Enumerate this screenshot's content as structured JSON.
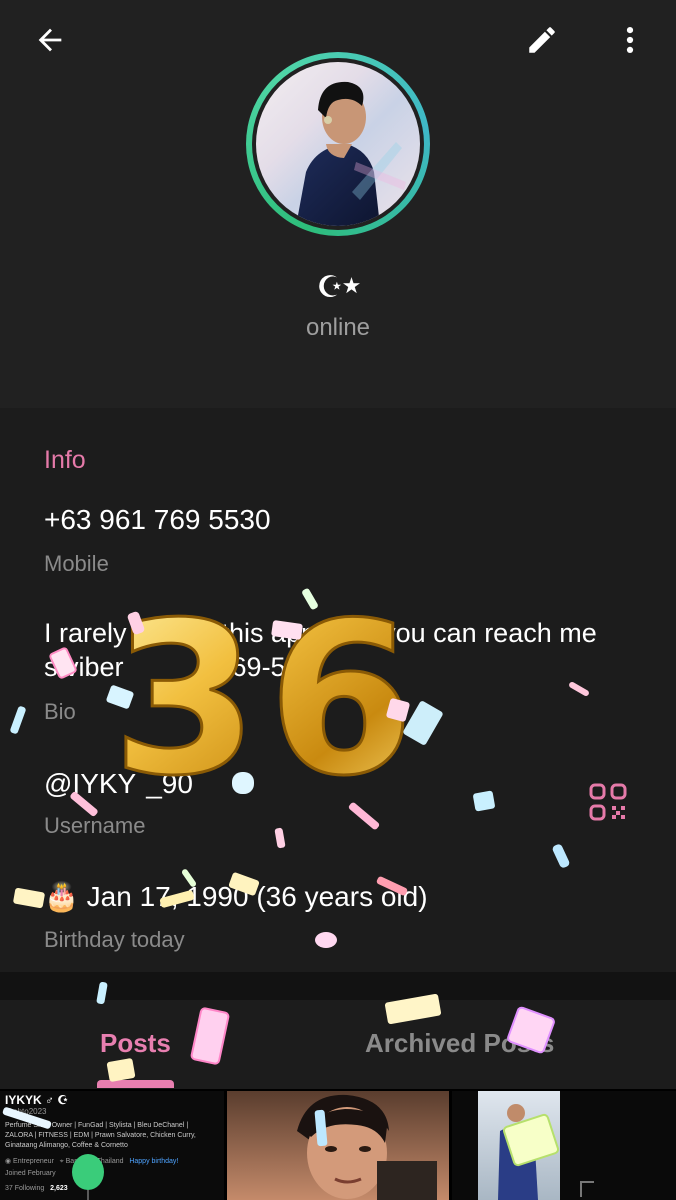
{
  "topbar": {
    "back_icon": "arrow-left-icon",
    "edit_icon": "pencil-icon",
    "more_icon": "more-vertical-icon"
  },
  "profile": {
    "name_emoji": "☪",
    "status": "online",
    "ring_color": "#2dbd7a"
  },
  "info": {
    "section_title": "Info",
    "phone": "+63 961 769 5530",
    "phone_label": "Mobile",
    "bio_line1": "I rarely c",
    "bio_line1b": "this app, b",
    "bio_line1c": "you can reach me",
    "bio_line2a": "s",
    "bio_line2b": " viber",
    "bio_line2c": "-769-5",
    "bio_label": "Bio",
    "username": "@IYKY",
    "username_tail": "_90",
    "username_label": "Username",
    "qr_icon": "qr-code-icon",
    "birthday_emoji": "🎂",
    "birthday": "Jan 17, 1990 (36 years old)",
    "birthday_label": "Birthday today"
  },
  "overlay": {
    "balloon_text": "36"
  },
  "tabs": [
    {
      "label": "Posts",
      "active": true
    },
    {
      "label": "Archived Posts",
      "active": false
    }
  ],
  "posts": {
    "post1": {
      "title": "IYKYK",
      "handle": "@ehto2023",
      "bio": "Perfume Shop Owner | FunGad | Stylista | Bleu DeChanel | ZALORA | FITNESS | EDM | Prawn Salvatore, Chicken Curry, Ginataang Alimango, Coffee & Cornetto",
      "location": "Bangkok, Thailand",
      "birthday_note": "Happy birthday!",
      "joined": "Joined February",
      "following": "37 Following",
      "followers": "2,623"
    }
  },
  "colors": {
    "accent_pink": "#e57aa9",
    "background": "#1c1c1c",
    "header_bg": "#212121",
    "muted": "#8a8a8a"
  }
}
